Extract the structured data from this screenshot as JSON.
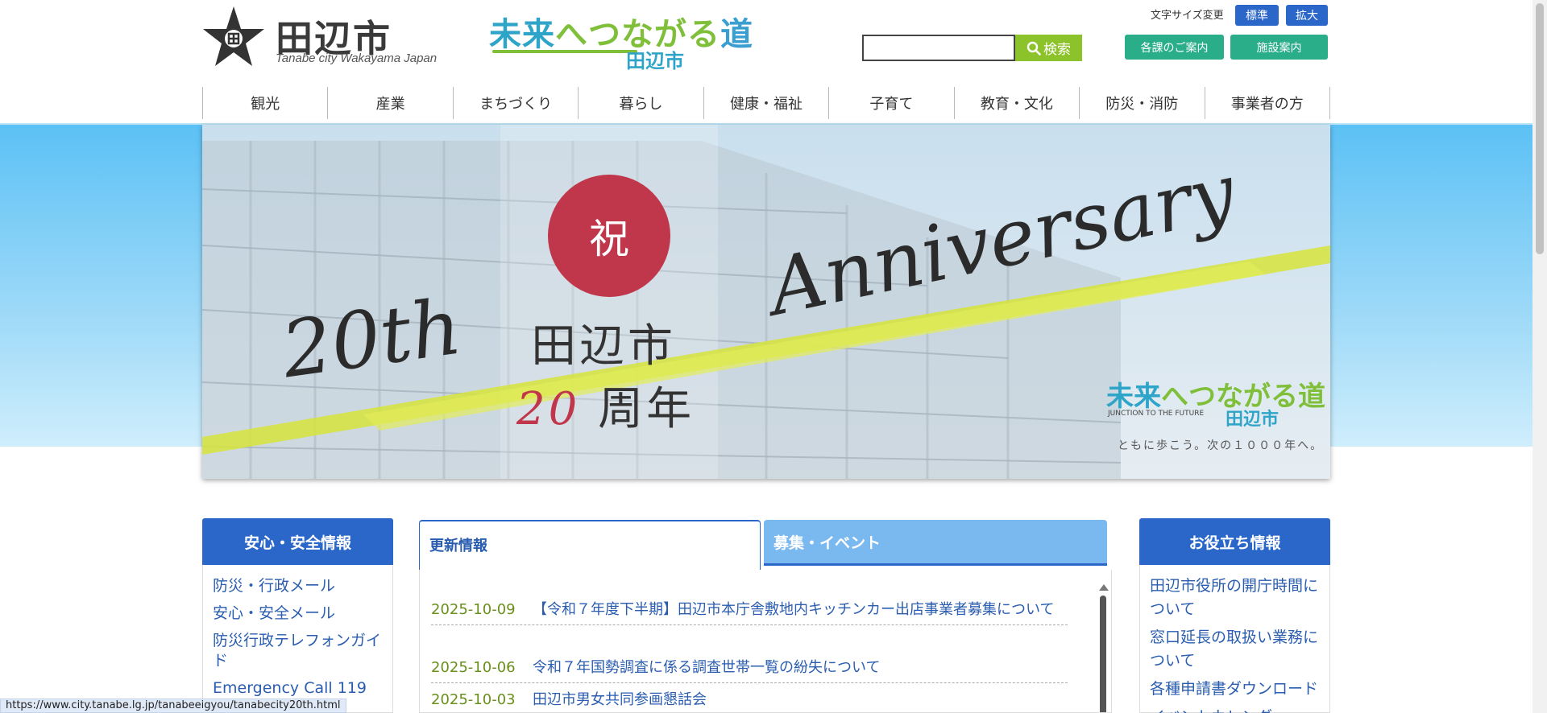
{
  "header": {
    "logo": {
      "name": "田辺市",
      "sub": "Tanabe city Wakayama Japan"
    },
    "slogan": {
      "part1": "未来",
      "part2": "へつながる",
      "part3": "道",
      "city": "田辺市"
    },
    "font_size_label": "文字サイズ変更",
    "font_size_standard": "標準",
    "font_size_large": "拡大",
    "search": {
      "value": "",
      "placeholder": "",
      "button_label": "検索"
    },
    "dept_guide_label": "各課のご案内",
    "facility_guide_label": "施設案内"
  },
  "nav": {
    "items": [
      {
        "label": "観光"
      },
      {
        "label": "産業"
      },
      {
        "label": "まちづくり"
      },
      {
        "label": "暮らし"
      },
      {
        "label": "健康・福祉"
      },
      {
        "label": "子育て"
      },
      {
        "label": "教育・文化"
      },
      {
        "label": "防災・消防"
      },
      {
        "label": "事業者の方"
      }
    ]
  },
  "hero": {
    "congrats": "祝",
    "text_20th": "20th",
    "text_anniversary": "Anniversary",
    "city": "田辺市",
    "num": "20",
    "years": "周年",
    "logo_part1": "未来",
    "logo_part2": "へつながる道",
    "logo_sub": "JUNCTION TO THE FUTURE",
    "logo_city": "田辺市",
    "tagline": "ともに歩こう。次の１０００年へ。"
  },
  "safety": {
    "title": "安心・安全情報",
    "links": [
      {
        "label": "防災・行政メール"
      },
      {
        "label": "安心・安全メール"
      },
      {
        "label": "防災行政テレフォンガイド"
      },
      {
        "label": "Emergency Call 119"
      }
    ]
  },
  "useful": {
    "title": "お役立ち情報",
    "links": [
      {
        "label": "田辺市役所の開庁時間について"
      },
      {
        "label": "窓口延長の取扱い業務について"
      },
      {
        "label": "各種申請書ダウンロード"
      },
      {
        "label": "イベントカレンダー"
      }
    ]
  },
  "tabs": {
    "active_label": "更新情報",
    "inactive_label": "募集・イベント"
  },
  "news": [
    {
      "date": "2025-10-09",
      "title": "【令和７年度下半期】田辺市本庁舎敷地内キッチンカー出店事業者募集について"
    },
    {
      "date": "2025-10-06",
      "title": "令和７年国勢調査に係る調査世帯一覧の紛失について"
    },
    {
      "date": "2025-10-03",
      "title": "田辺市男女共同参画懇話会"
    }
  ],
  "status_bar": {
    "url": "https://www.city.tanabe.lg.jp/tanabeeigyou/tanabecity20th.html"
  },
  "colors": {
    "primary_blue": "#2a67c9",
    "green": "#2aae8a",
    "search_green": "#8cc32b",
    "anniversary_red": "#c0364a",
    "date_green": "#6a8f1a"
  }
}
